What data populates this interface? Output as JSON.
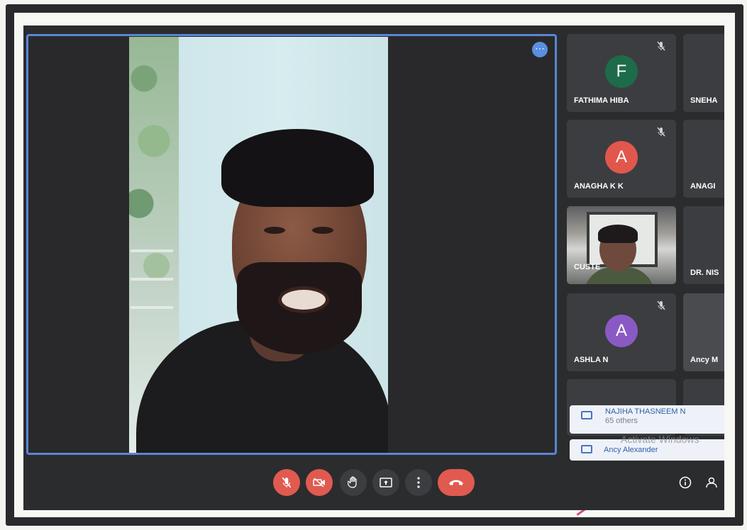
{
  "participants": [
    {
      "name": "FATHIMA HIBA",
      "initial": "F",
      "color": "#1e6b4a",
      "muted": true
    },
    {
      "name": "SNEHA",
      "initial": "",
      "color": "",
      "muted": false
    },
    {
      "name": "ANAGHA K K",
      "initial": "A",
      "color": "#e2574c",
      "muted": true
    },
    {
      "name": "ANAGI",
      "initial": "",
      "color": "",
      "muted": false
    },
    {
      "name": "CUSTE",
      "initial": "",
      "color": "",
      "muted": false
    },
    {
      "name": "DR. NIS",
      "initial": "",
      "color": "",
      "muted": false
    },
    {
      "name": "ASHLA N",
      "initial": "A",
      "color": "#8a5ac4",
      "muted": true
    },
    {
      "name": "Ancy M",
      "initial": "",
      "color": "",
      "muted": false
    }
  ],
  "notifications": [
    {
      "title": "NAJIHA THASNEEM N",
      "subtitle": "65 others"
    },
    {
      "title": "Ancy Alexander",
      "subtitle": ""
    }
  ],
  "watermark": "Activate Windows",
  "controls": {
    "more_label": "⋯",
    "mic": "mic-off-icon",
    "camera": "camera-off-icon",
    "hand": "raise-hand-icon",
    "present": "present-icon",
    "more": "more-options-icon",
    "end": "end-call-icon",
    "info": "info-icon",
    "people": "people-icon"
  },
  "colors": {
    "accent": "#5a86d6",
    "danger": "#e05a50"
  }
}
